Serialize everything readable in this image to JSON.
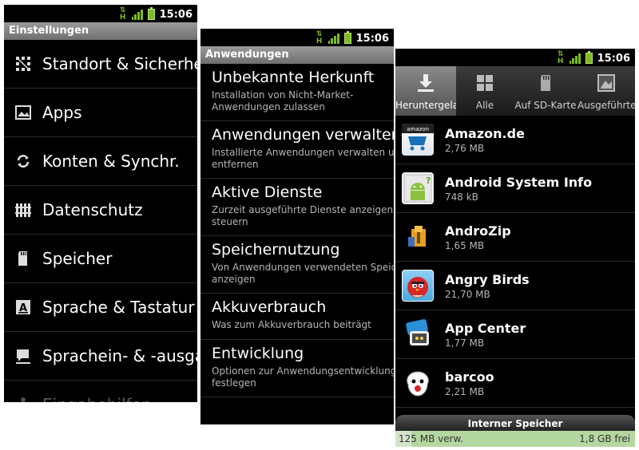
{
  "status": {
    "time": "15:06"
  },
  "settings_screen": {
    "title": "Einstellungen",
    "items": [
      {
        "label": "Standort & Sicherheit",
        "icon": "location-grid-icon"
      },
      {
        "label": "Apps",
        "icon": "apps-picture-icon"
      },
      {
        "label": "Konten & Synchr.",
        "icon": "sync-icon"
      },
      {
        "label": "Datenschutz",
        "icon": "privacy-fence-icon"
      },
      {
        "label": "Speicher",
        "icon": "sd-card-icon"
      },
      {
        "label": "Sprache & Tastatur",
        "icon": "language-keyboard-icon"
      },
      {
        "label": "Sprachein- & -ausgabe",
        "icon": "voice-icon"
      },
      {
        "label": "Eingabehilfen",
        "icon": "accessibility-icon"
      }
    ]
  },
  "apps_screen": {
    "title": "Anwendungen",
    "items": [
      {
        "title": "Unbekannte Herkunft",
        "sub": "Installation von Nicht-Market-\nAnwendungen zulassen"
      },
      {
        "title": "Anwendungen verwalten",
        "sub": "Installierte Anwendungen verwalten und\nentfernen"
      },
      {
        "title": "Aktive Dienste",
        "sub": "Zurzeit ausgeführte Dienste anzeigen und\nsteuern"
      },
      {
        "title": "Speichernutzung",
        "sub": "Von Anwendungen verwendeten Speicher\nanzeigen"
      },
      {
        "title": "Akkuverbrauch",
        "sub": "Was zum Akkuverbrauch beiträgt"
      },
      {
        "title": "Entwicklung",
        "sub": "Optionen zur Anwendungsentwicklung\nfestlegen"
      }
    ]
  },
  "manage_screen": {
    "tabs": [
      {
        "label": "Heruntergeladen",
        "icon": "download-icon",
        "active": true
      },
      {
        "label": "Alle",
        "icon": "grid-icon",
        "active": false
      },
      {
        "label": "Auf SD-Karte",
        "icon": "sd-card-icon",
        "active": false
      },
      {
        "label": "Ausgeführte",
        "icon": "running-icon",
        "active": false
      }
    ],
    "apps": [
      {
        "name": "Amazon.de",
        "size": "2,76 MB",
        "icon": "amazon-icon"
      },
      {
        "name": "Android System Info",
        "size": "748 kB",
        "icon": "android-system-info-icon"
      },
      {
        "name": "AndroZip",
        "size": "1,65 MB",
        "icon": "androzip-icon"
      },
      {
        "name": "Angry Birds",
        "size": "21,70 MB",
        "icon": "angry-birds-icon"
      },
      {
        "name": "App Center",
        "size": "1,77 MB",
        "icon": "app-center-icon"
      },
      {
        "name": "barcoo",
        "size": "2,21 MB",
        "icon": "barcoo-icon"
      }
    ],
    "storage": {
      "title": "Interner Speicher",
      "used": "125 MB verw.",
      "free": "1,8 GB frei",
      "used_fraction": 0.065
    }
  }
}
